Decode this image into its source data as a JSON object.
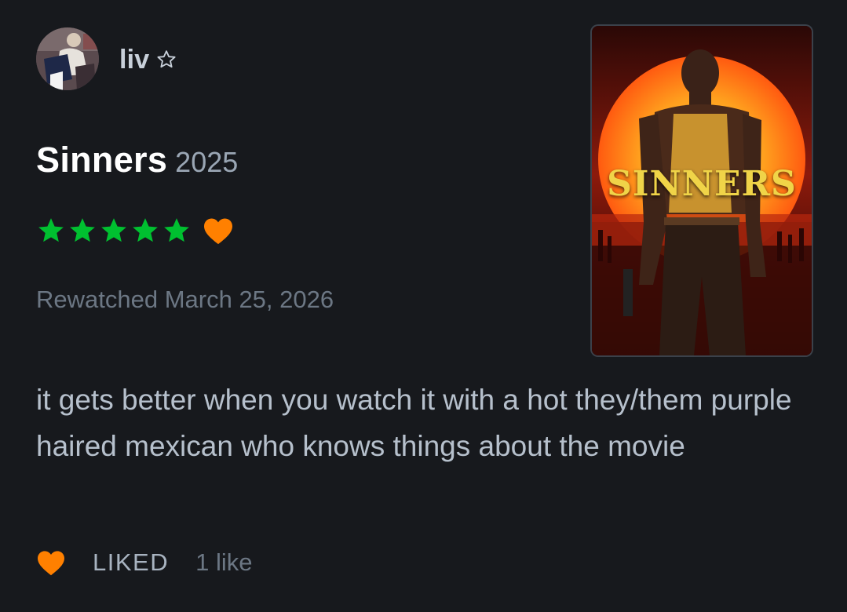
{
  "user": {
    "name": "liv",
    "patron_icon": "star-outline-icon"
  },
  "film": {
    "title": "Sinners",
    "year": "2025",
    "poster_title": "SINNERS"
  },
  "rating": {
    "stars": 5,
    "max_stars": 5,
    "liked": true,
    "star_color": "#00c030",
    "heart_color": "#ff8000"
  },
  "watched": {
    "text": "Rewatched March 25, 2026"
  },
  "review": {
    "text": "it gets better when you watch it with a hot they/them purple haired mexican who knows things about the movie"
  },
  "footer": {
    "liked_label": "LIKED",
    "like_count": "1 like"
  },
  "colors": {
    "background": "#17191d",
    "accent_green": "#00c030",
    "accent_orange": "#ff8000",
    "muted_text": "#6c7784"
  }
}
